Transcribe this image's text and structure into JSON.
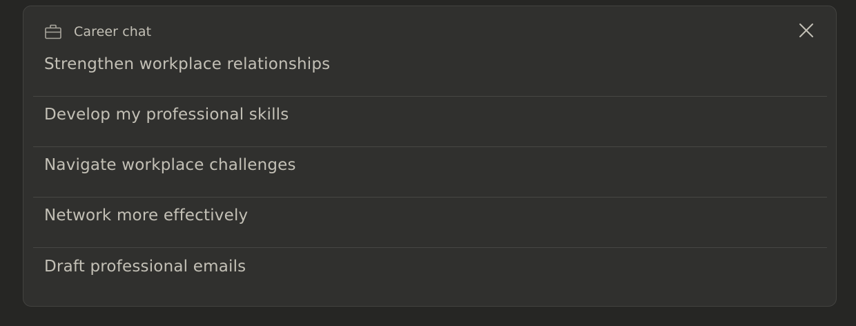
{
  "header": {
    "icon": "briefcase-icon",
    "title": "Career chat",
    "close_icon": "close-icon"
  },
  "suggestions": [
    {
      "label": "Strengthen workplace relationships"
    },
    {
      "label": "Develop my professional skills"
    },
    {
      "label": "Navigate workplace challenges"
    },
    {
      "label": "Network more effectively"
    },
    {
      "label": "Draft professional emails"
    }
  ],
  "colors": {
    "background": "#262624",
    "panel": "#30302e",
    "text": "#c3c0b6",
    "divider": "#474744"
  }
}
